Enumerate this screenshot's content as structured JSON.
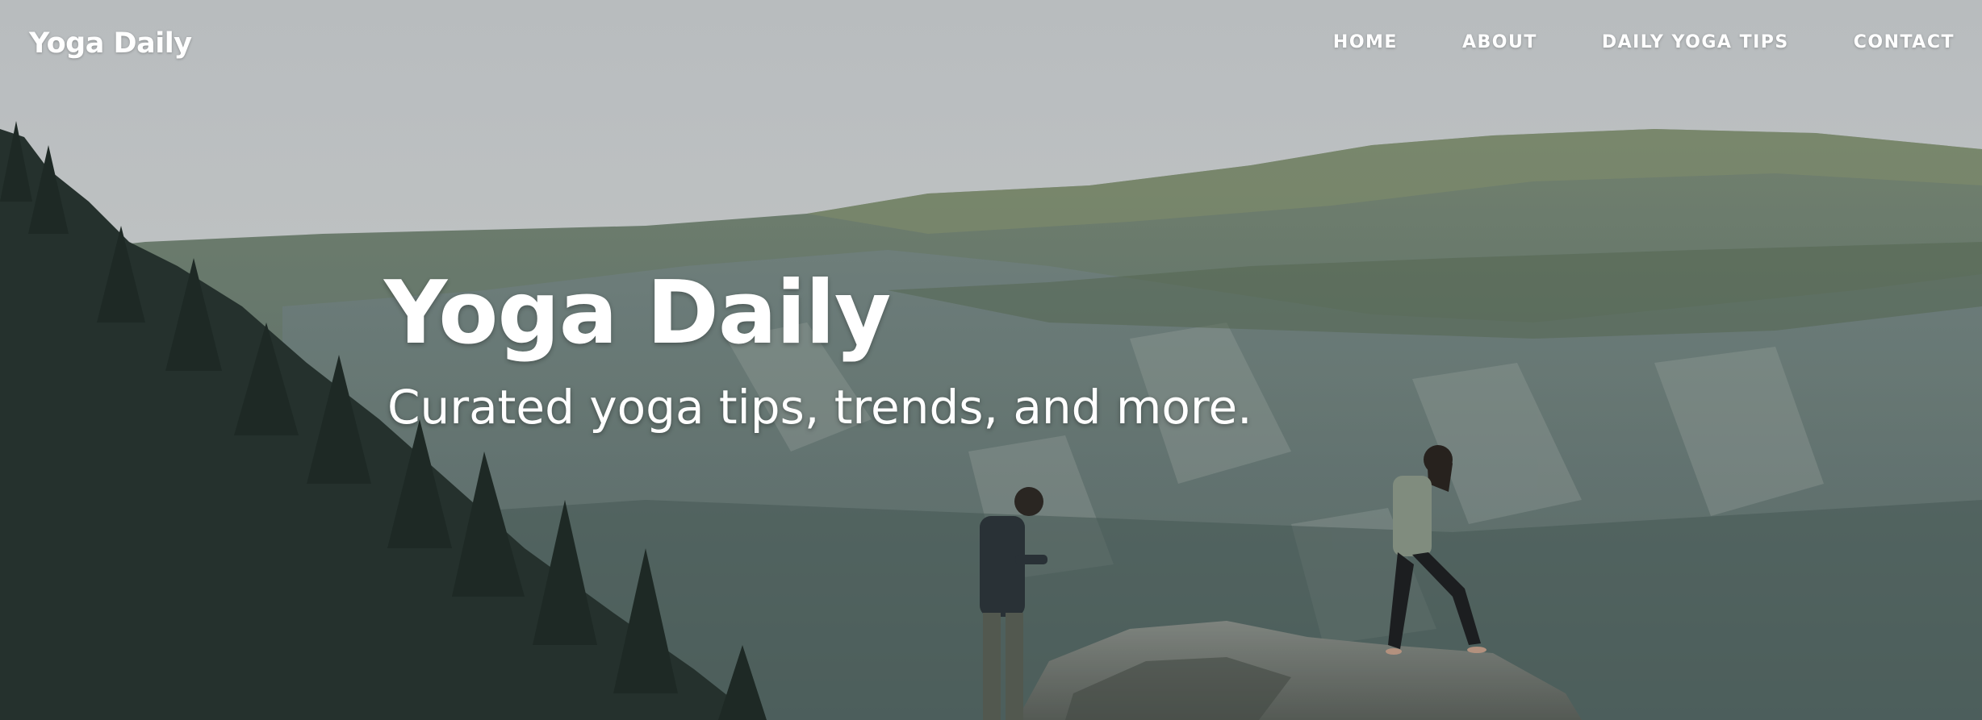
{
  "site": {
    "brand": "Yoga Daily"
  },
  "nav": {
    "items": [
      {
        "label": "HOME"
      },
      {
        "label": "ABOUT"
      },
      {
        "label": "DAILY YOGA TIPS"
      },
      {
        "label": "CONTACT"
      }
    ]
  },
  "hero": {
    "title": "Yoga Daily",
    "subtitle": "Curated yoga tips, trends, and more.",
    "background_description_icon": "mountain-landscape-image"
  },
  "colors": {
    "text": "#ffffff",
    "sky": "#d8dadc",
    "forest": "#2f3d36",
    "mountain": "#6f7f78"
  }
}
